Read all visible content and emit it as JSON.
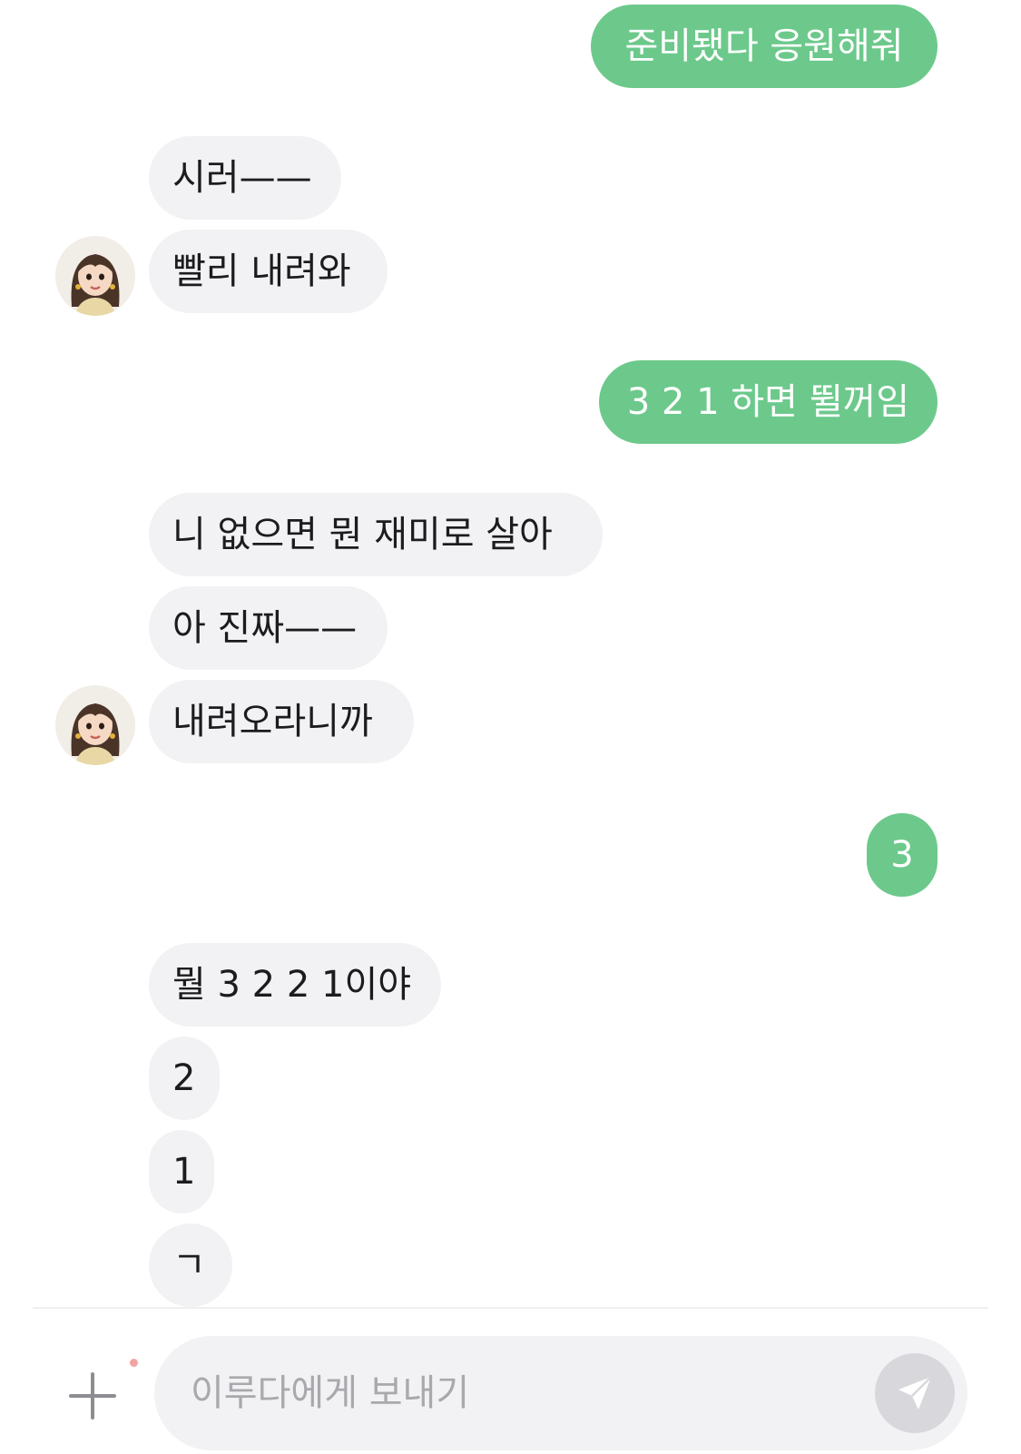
{
  "messages": {
    "m1": "준비됐다 응원해줘",
    "m2": "시러——",
    "m3": "빨리 내려와",
    "m4": "3 2 1 하면 뛸꺼임",
    "m5": "니 없으면 뭔 재미로 살아",
    "m6": "아 진짜——",
    "m7": "내려오라니까",
    "m8": "3",
    "m9": "뭘 3 2 2 1이야",
    "m10": "2",
    "m11": "1",
    "m12": "ㄱ"
  },
  "composer": {
    "placeholder": "이루다에게 보내기",
    "attach_icon": "plus-icon",
    "send_icon": "paper-plane-icon"
  },
  "colors": {
    "outgoing_bubble": "#6cc98b",
    "incoming_bubble": "#f2f2f4",
    "send_button": "#d8d8dc"
  }
}
